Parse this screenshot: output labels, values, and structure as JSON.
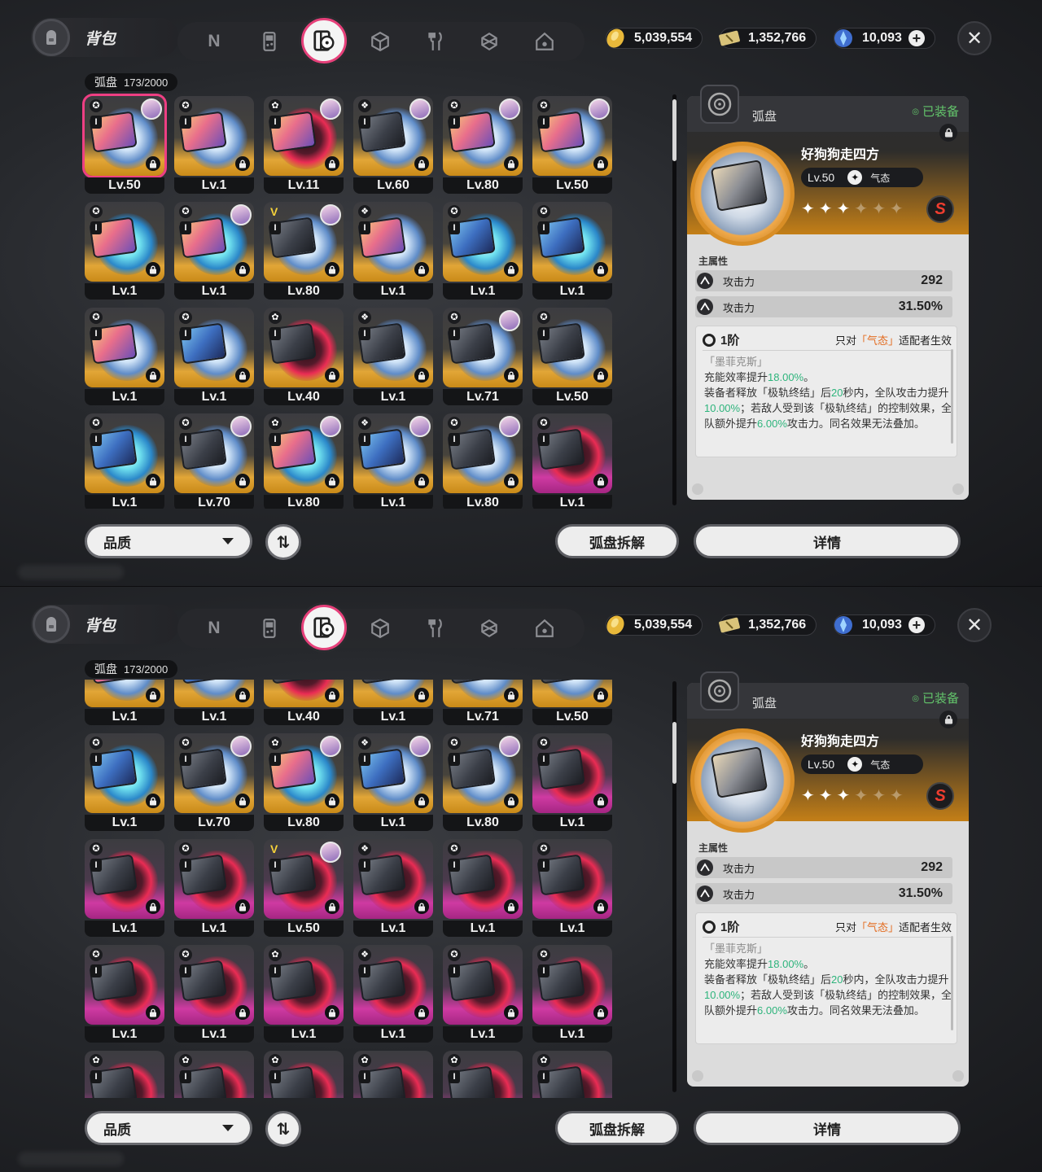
{
  "header": {
    "bag_title": "背包",
    "tabs": [
      "n-icon",
      "gameboy-icon",
      "disc-icon",
      "cube-icon",
      "fork-knife-icon",
      "gem-box-icon",
      "home-icon"
    ],
    "active_tab": 2,
    "currency": [
      {
        "name": "gold-coin-icon",
        "value": "5,039,554"
      },
      {
        "name": "ticket-icon",
        "value": "1,352,766"
      },
      {
        "name": "polychrome-icon",
        "value": "10,093"
      }
    ],
    "close": "✕"
  },
  "category": {
    "label": "弧盘",
    "count": "173/2000"
  },
  "controls": {
    "sort_label": "品质",
    "order_icon": "⇅",
    "dismantle": "弧盘拆解",
    "details": "详情"
  },
  "panel1": {
    "levels": [
      "Lv.50",
      "Lv.1",
      "Lv.11",
      "Lv.60",
      "Lv.80",
      "Lv.50",
      "Lv.1",
      "Lv.1",
      "Lv.80",
      "Lv.1",
      "Lv.1",
      "Lv.1",
      "Lv.1",
      "Lv.1",
      "Lv.40",
      "Lv.1",
      "Lv.71",
      "Lv.50",
      "Lv.1",
      "Lv.70",
      "Lv.80",
      "Lv.1",
      "Lv.80",
      "Lv.1"
    ]
  },
  "panel2": {
    "levels": [
      "Lv.1",
      "Lv.1",
      "Lv.40",
      "Lv.1",
      "Lv.71",
      "Lv.50",
      "Lv.1",
      "Lv.70",
      "Lv.80",
      "Lv.1",
      "Lv.80",
      "Lv.1",
      "Lv.1",
      "Lv.1",
      "Lv.50",
      "Lv.1",
      "Lv.1",
      "Lv.1",
      "Lv.1",
      "Lv.1",
      "Lv.1",
      "Lv.1",
      "Lv.1",
      "Lv.1"
    ]
  },
  "detail": {
    "category": "弧盘",
    "equipped": "已装备",
    "name": "好狗狗走四方",
    "level": "Lv.50",
    "attribute": "气态",
    "stars_filled": 3,
    "stars_total": 6,
    "rank": "S",
    "main_stats_title": "主属性",
    "stats": [
      {
        "label": "攻击力",
        "value": "292"
      },
      {
        "label": "攻击力",
        "value": "31.50%"
      }
    ],
    "effect": {
      "tier": "1阶",
      "cond_prefix": "只对",
      "cond_highlight": "「气态」",
      "cond_suffix": "适配者生效",
      "source": "「墨菲克斯」",
      "line1_a": "充能效率提升",
      "line1_b": "18.00%",
      "line1_c": "。",
      "line2_a": "装备者释放「极轨终结」后",
      "line2_b": "20",
      "line2_c": "秒内，全队攻击力提升",
      "line2_d": "10.00%",
      "line2_e": "；若敌人受到该「极轨终结」的控制效果，全队额外提升",
      "line2_f": "6.00%",
      "line2_g": "攻击力。同名效果无法叠加。"
    }
  },
  "colors": {
    "accent": "#ee3f83",
    "gold_rarity": "#e2a637",
    "purple_rarity": "#cf3aa2",
    "buff_green": "#2eb47c",
    "cond_orange": "#e36b1f"
  }
}
